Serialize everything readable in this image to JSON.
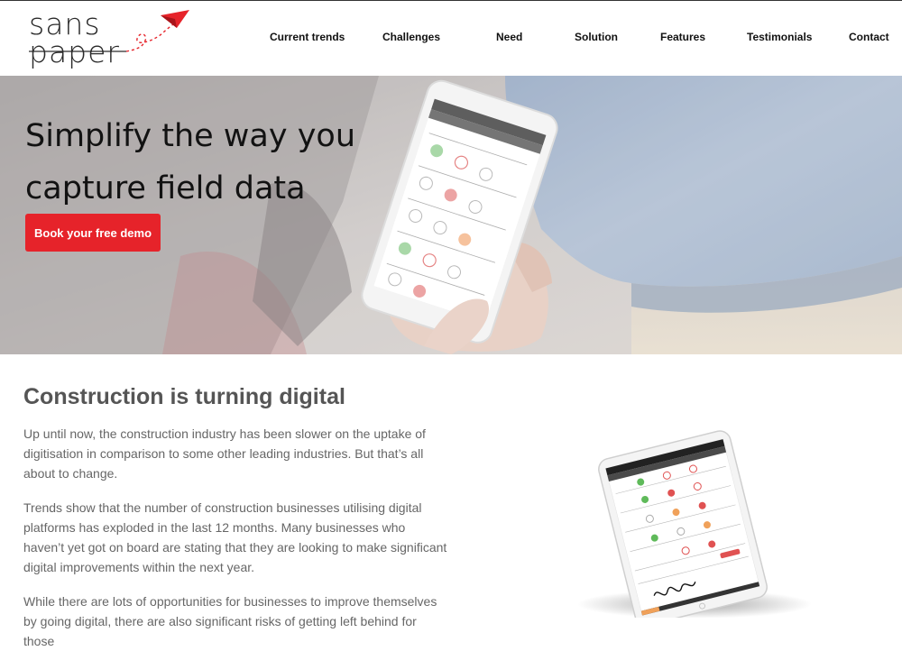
{
  "logo": {
    "line1": "sans",
    "line2": "paper",
    "accent_color": "#e6232a"
  },
  "nav": {
    "items": [
      {
        "label": "Current trends"
      },
      {
        "label": "Challenges"
      },
      {
        "label": "Need"
      },
      {
        "label": "Solution"
      },
      {
        "label": "Features"
      },
      {
        "label": "Testimonials"
      },
      {
        "label": "Contact"
      }
    ]
  },
  "hero": {
    "title": "Simplify the way you capture field data",
    "cta_label": "Book your free demo",
    "cta_color": "#e6232a"
  },
  "content": {
    "title": "Construction is turning digital",
    "paragraphs": [
      "Up until now, the construction industry has been slower on the uptake of digitisation in comparison to some other leading industries. But that’s all about to change.",
      "Trends show that the number of construction businesses utilising digital platforms has exploded in the last 12 months. Many businesses who haven’t yet got on board are stating that they are looking to make significant digital improvements within the next year.",
      "While there are lots of opportunities for businesses to improve themselves by going digital, there are also significant risks of getting left behind for those"
    ]
  }
}
